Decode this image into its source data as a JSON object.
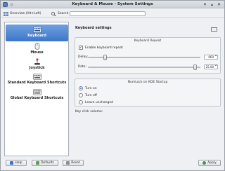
{
  "window": {
    "title": "Keyboard & Mouse - System Settings"
  },
  "toolbar": {
    "overview_label": "Overview (Alt+Left)",
    "search_label": "Search",
    "search_placeholder": ""
  },
  "sidebar": {
    "items": [
      {
        "label": "Keyboard",
        "icon": "keyboard-icon",
        "active": true
      },
      {
        "label": "Mouse",
        "icon": "mouse-icon",
        "active": false
      },
      {
        "label": "Joystick",
        "icon": "joystick-icon",
        "active": false
      },
      {
        "label": "Standard Keyboard Shortcuts",
        "icon": "keyboard-shortcuts-icon",
        "active": false
      },
      {
        "label": "Global Keyboard Shortcuts",
        "icon": "global-shortcuts-icon",
        "active": false
      }
    ]
  },
  "main": {
    "section_title": "Keyboard settings",
    "repeat": {
      "title": "Keyboard Repeat",
      "enable_label": "Enable keyboard repeat",
      "enabled": true,
      "delay_label": "Delay:",
      "delay_value": "660",
      "rate_label": "Rate:",
      "rate_value": "25.00"
    },
    "numlock": {
      "title": "NumLock on KDE Startup",
      "options": [
        {
          "label": "Turn on",
          "selected": true
        },
        {
          "label": "Turn off",
          "selected": false
        },
        {
          "label": "Leave unchanged",
          "selected": false
        }
      ]
    },
    "key_click_label": "Key click volume:"
  },
  "buttons": {
    "help": "Help",
    "defaults": "Defaults",
    "reset": "Reset",
    "apply": "Apply"
  },
  "colors": {
    "accent": "#3d75c9",
    "window_bg": "#eef0f3"
  }
}
